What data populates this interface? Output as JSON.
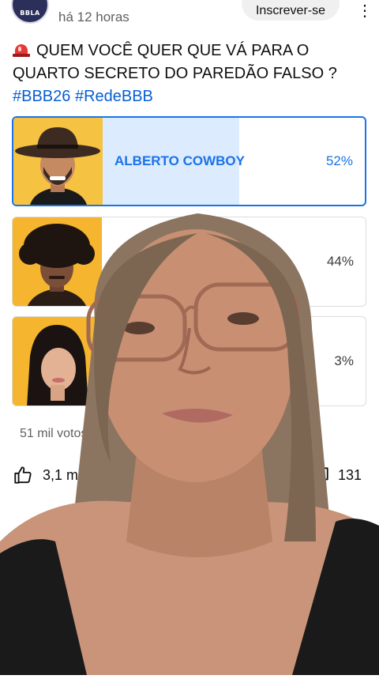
{
  "header": {
    "channel_badge": "BBLA",
    "timestamp": "há 12 horas",
    "subscribe_label": "Inscrever-se",
    "menu_icon": "kebab-menu-icon"
  },
  "post": {
    "title": "QUEM VOCÊ QUER QUE VÁ PARA O QUARTO SECRETO DO PAREDÃO FALSO ?",
    "hashtags": "#BBB26 #RedeBBB",
    "emoji_icon": "police-siren-icon"
  },
  "poll": {
    "options": [
      {
        "label": "ALBERTO COWBOY",
        "percent": "52%",
        "share": 0.52,
        "selected": true
      },
      {
        "label": "",
        "percent": "44%",
        "share": 0.44,
        "selected": false
      },
      {
        "label": "",
        "percent": "3%",
        "share": 0.03,
        "selected": false
      }
    ],
    "votes": "51 mil votos"
  },
  "actions": {
    "like_count": "3,1 mil",
    "comment_count": "131"
  },
  "colors": {
    "accent": "#1a73e8",
    "poll_fill": "#dcebfd",
    "photo_bg": "#f5c242",
    "hashtag": "#065fd4"
  }
}
